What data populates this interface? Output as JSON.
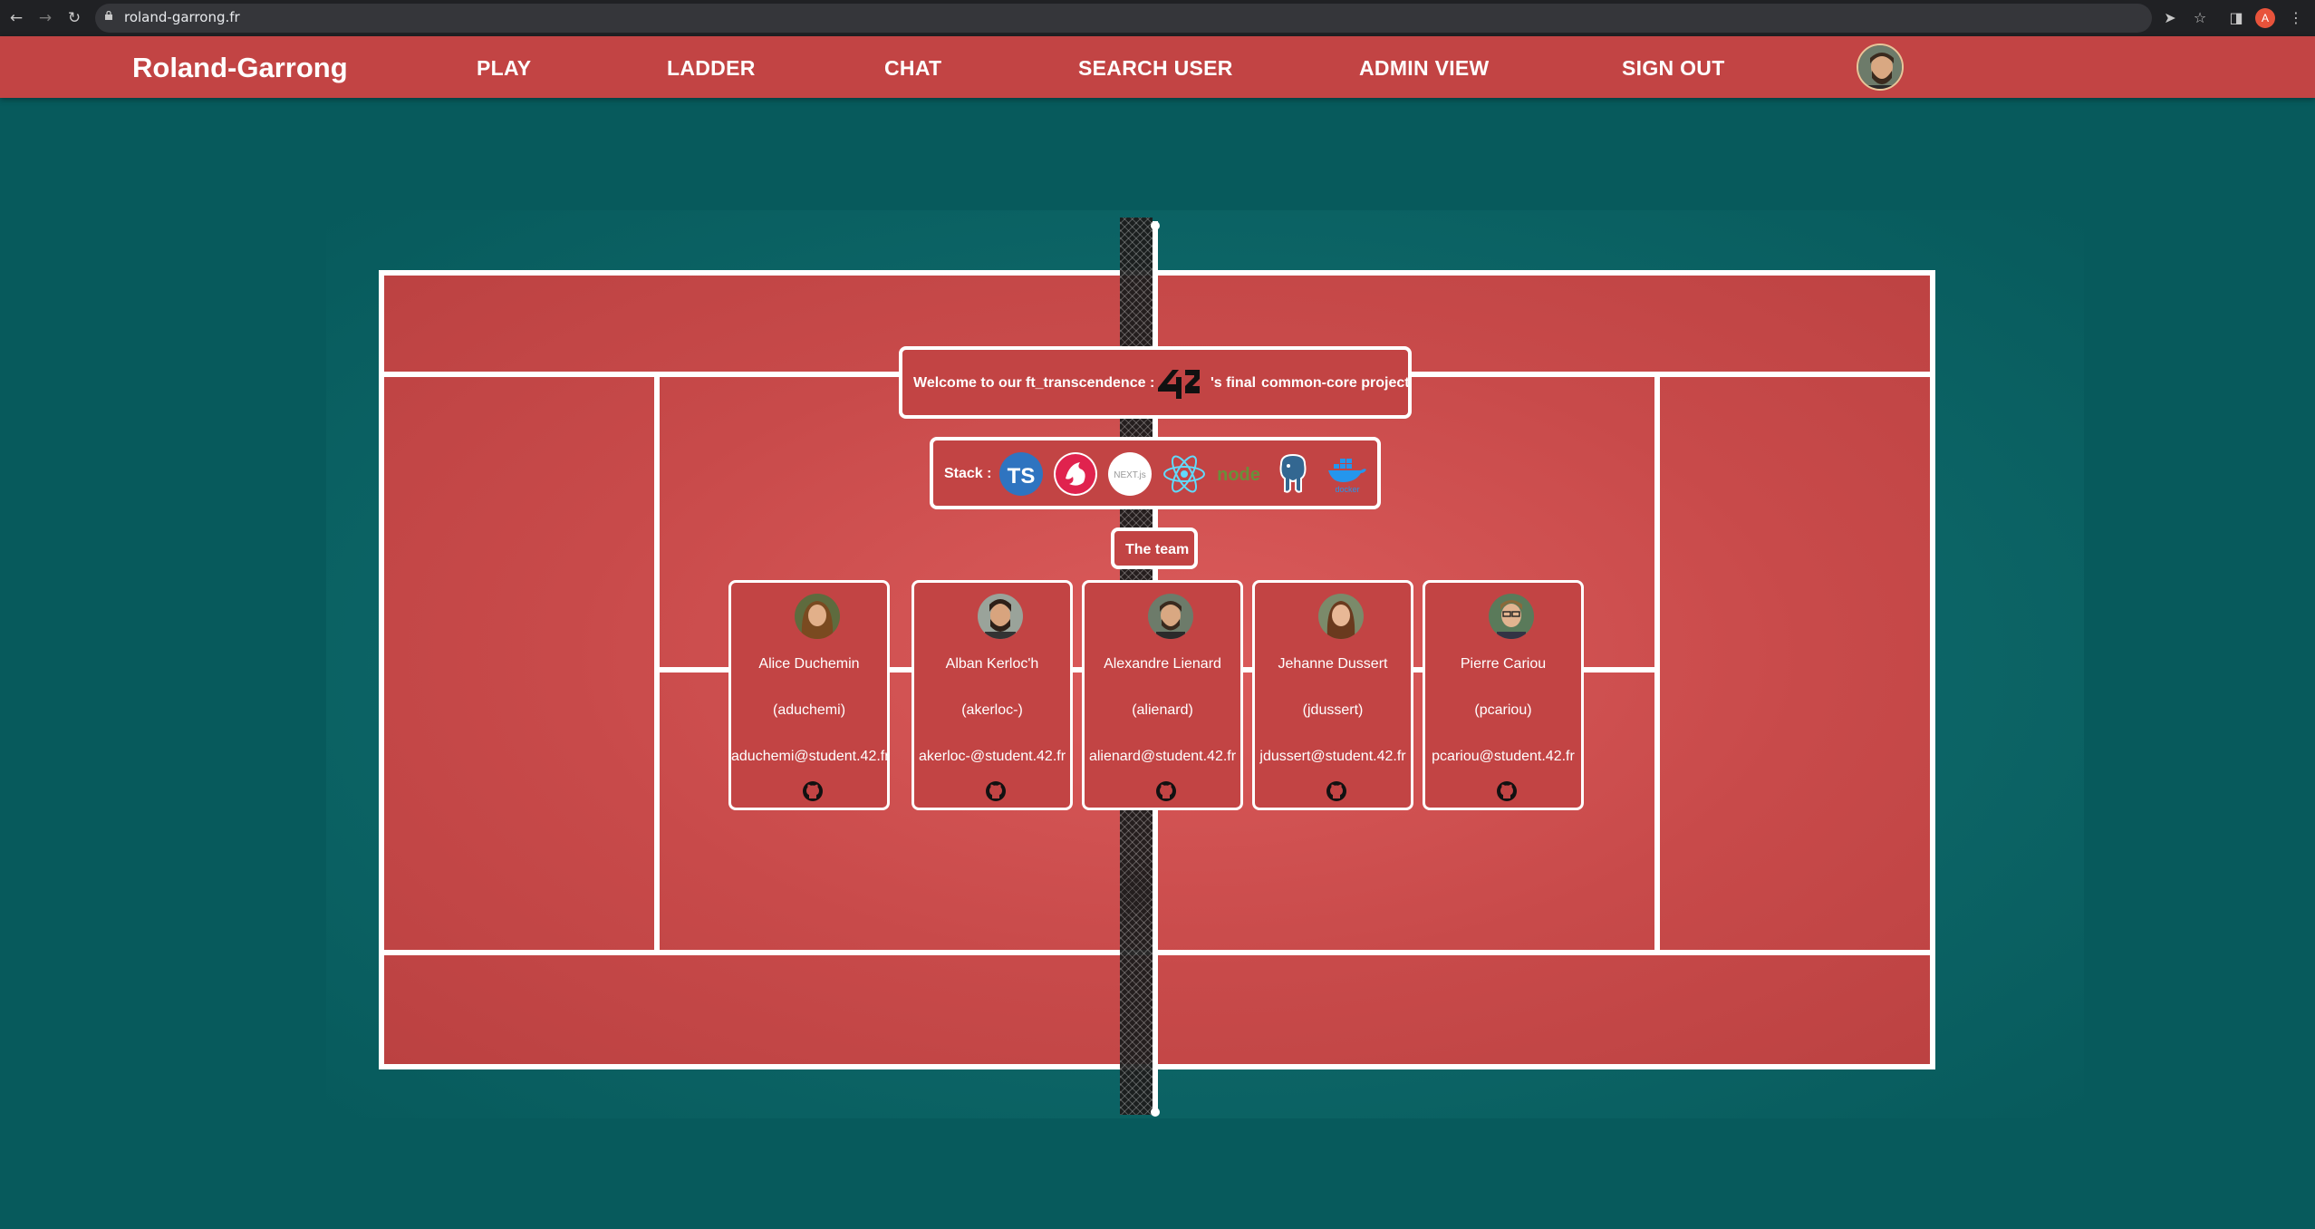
{
  "browser": {
    "url": "roland-garrong.fr",
    "profile_initial": "A"
  },
  "header": {
    "brand": "Roland-Garrong",
    "nav": [
      "PLAY",
      "LADDER",
      "CHAT",
      "SEARCH USER",
      "ADMIN VIEW",
      "SIGN OUT"
    ]
  },
  "welcome": {
    "prefix": "Welcome to our",
    "project": "ft_transcendence :",
    "logo_text": "42",
    "suffix": "'s final",
    "tail": "common-core project"
  },
  "stack": {
    "label": "Stack :",
    "icons": [
      "typescript-icon",
      "nestjs-icon",
      "nextjs-icon",
      "react-icon",
      "nodejs-icon",
      "postgresql-icon",
      "docker-icon"
    ],
    "ts_text": "TS",
    "next_text": "NEXT.js",
    "node_text": "node",
    "docker_text": "docker"
  },
  "team": {
    "title": "The team",
    "members": [
      {
        "name": "Alice Duchemin",
        "login": "(aduchemi)",
        "email": "aduchemi@student.42.fr"
      },
      {
        "name": "Alban Kerloc'h",
        "login": "(akerloc-)",
        "email": "akerloc-@student.42.fr"
      },
      {
        "name": "Alexandre Lienard",
        "login": "(alienard)",
        "email": "alienard@student.42.fr"
      },
      {
        "name": "Jehanne Dussert",
        "login": "(jdussert)",
        "email": "jdussert@student.42.fr"
      },
      {
        "name": "Pierre Cariou",
        "login": "(pcariou)",
        "email": "pcariou@student.42.fr"
      }
    ]
  },
  "colors": {
    "header": "#c24444",
    "background": "#075a5c",
    "court": "#c84a4a"
  }
}
